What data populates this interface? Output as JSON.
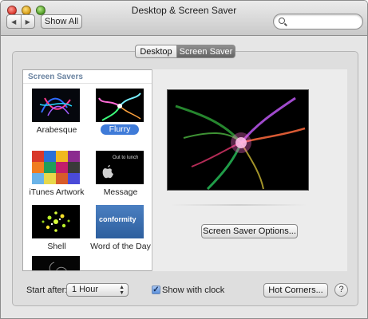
{
  "window": {
    "title": "Desktop & Screen Saver",
    "back_glyph": "◀",
    "forward_glyph": "▶",
    "show_all_label": "Show All",
    "search_placeholder": "",
    "search_icon": "magnifier-icon"
  },
  "tabs": [
    {
      "label": "Desktop",
      "selected": false
    },
    {
      "label": "Screen Saver",
      "selected": true
    }
  ],
  "screen_savers": {
    "header": "Screen Savers",
    "items": [
      {
        "label": "Arabesque",
        "selected": false
      },
      {
        "label": "Flurry",
        "selected": true
      },
      {
        "label": "iTunes Artwork",
        "selected": false
      },
      {
        "label": "Message",
        "selected": false,
        "thumb_text": "Out to lunch"
      },
      {
        "label": "Shell",
        "selected": false
      },
      {
        "label": "Word of the Day",
        "selected": false,
        "thumb_text": "conformity"
      },
      {
        "label": "",
        "selected": false
      }
    ]
  },
  "preview": {
    "options_button_label": "Screen Saver Options..."
  },
  "footer": {
    "start_after_label": "Start after:",
    "start_after_value": "1 Hour",
    "show_clock_label": "Show with clock",
    "show_clock_checked": true,
    "checkmark_glyph": "✓",
    "hot_corners_label": "Hot Corners...",
    "help_label": "?"
  },
  "colors": {
    "selection_blue": "#3f7bd8",
    "header_blue": "#6a83a0",
    "active_tab": "#6b6b6b"
  }
}
